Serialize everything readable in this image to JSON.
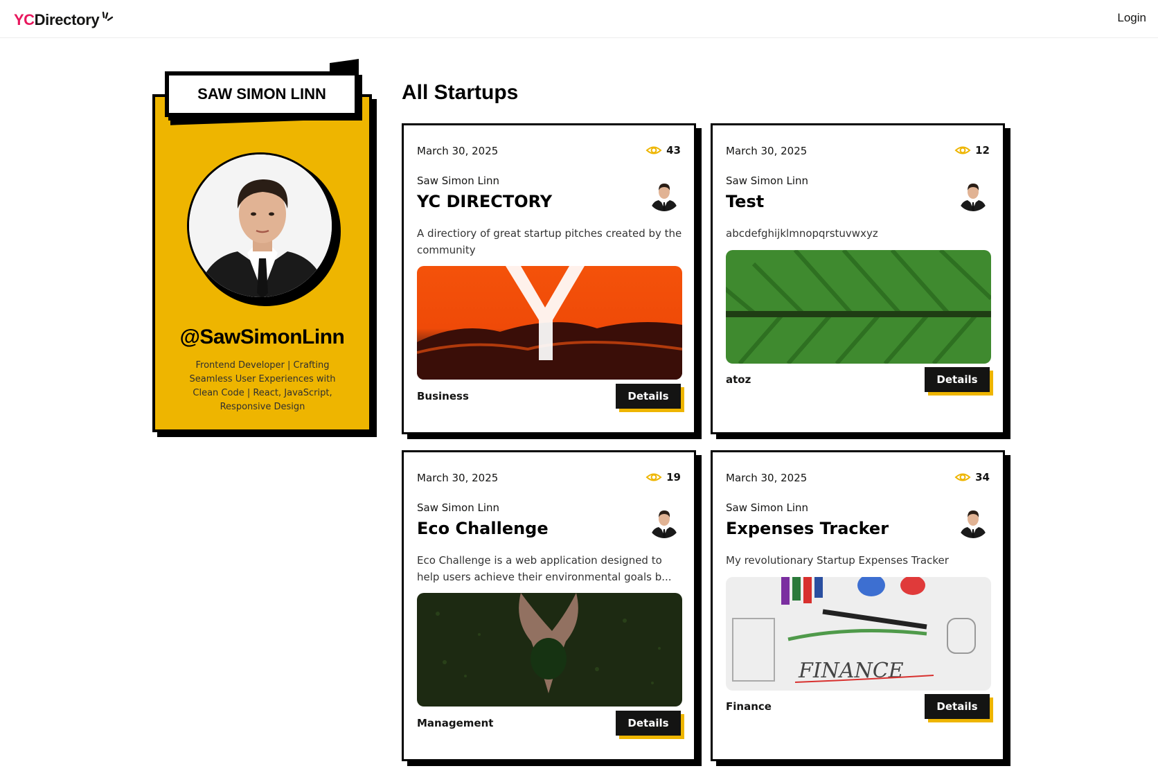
{
  "navbar": {
    "logo_yc": "YC",
    "logo_rest": "Directory",
    "login_label": "Login"
  },
  "profile": {
    "name": "SAW SIMON LINN",
    "username": "@SawSimonLinn",
    "bio": "Frontend Developer | Crafting Seamless User Experiences with Clean Code | React, JavaScript, Responsive Design"
  },
  "section_title": "All Startups",
  "accent_color": "#EEB500",
  "brand_color": "#E8175D",
  "startups": [
    {
      "date": "March 30, 2025",
      "views": "43",
      "author": "Saw Simon Linn",
      "title": "YC DIRECTORY",
      "description": "A directiory of great startup pitches created by the community",
      "category": "Business",
      "button": "Details"
    },
    {
      "date": "March 30, 2025",
      "views": "12",
      "author": "Saw Simon Linn",
      "title": "Test",
      "description": "abcdefghijklmnopqrstuvwxyz",
      "category": "atoz",
      "button": "Details"
    },
    {
      "date": "March 30, 2025",
      "views": "19",
      "author": "Saw Simon Linn",
      "title": "Eco Challenge",
      "description": "Eco Challenge is a web application designed to help users achieve their environmental goals b...",
      "category": "Management",
      "button": "Details"
    },
    {
      "date": "March 30, 2025",
      "views": "34",
      "author": "Saw Simon Linn",
      "title": "Expenses Tracker",
      "description": "My revolutionary Startup Expenses Tracker",
      "category": "Finance",
      "button": "Details"
    }
  ]
}
